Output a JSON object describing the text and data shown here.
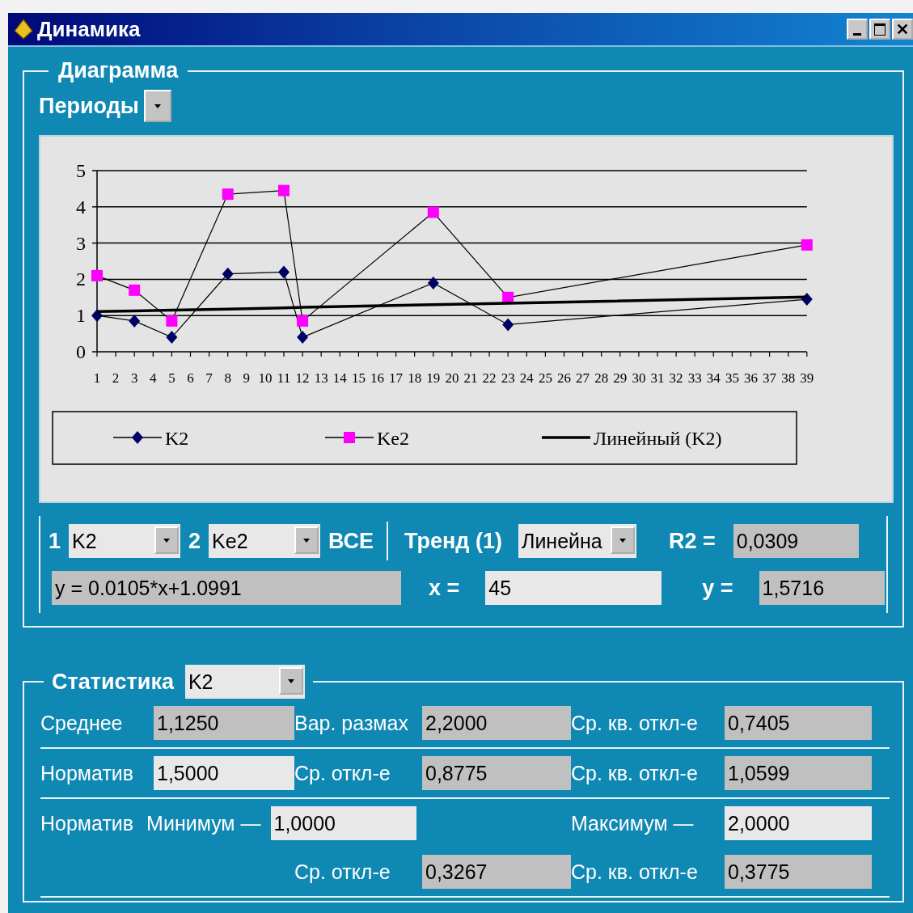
{
  "window": {
    "title": "Динамика"
  },
  "diagram": {
    "title": "Диаграмма",
    "periods_label": "Периоды",
    "chart_data": {
      "type": "line",
      "x": [
        1,
        3,
        5,
        8,
        11,
        12,
        19,
        23,
        39
      ],
      "series": [
        {
          "name": "K2",
          "color": "#000066",
          "marker": "diamond",
          "values": [
            1.0,
            0.85,
            0.4,
            2.15,
            2.2,
            0.4,
            1.9,
            0.75,
            1.45
          ]
        },
        {
          "name": "Ke2",
          "color": "#ff00ff",
          "marker": "square",
          "values": [
            2.1,
            1.7,
            0.85,
            4.35,
            4.45,
            0.85,
            3.85,
            1.5,
            2.95
          ]
        },
        {
          "name": "Линейный (K2)",
          "color": "#000000",
          "marker": "none",
          "values": [
            1.11,
            1.13,
            1.15,
            1.18,
            1.21,
            1.23,
            1.3,
            1.34,
            1.51
          ]
        }
      ],
      "xlim": [
        1,
        39
      ],
      "ylim": [
        0,
        5
      ],
      "grid": true,
      "legend": true,
      "xticks": [
        1,
        2,
        3,
        4,
        5,
        6,
        7,
        8,
        9,
        10,
        11,
        12,
        13,
        14,
        15,
        16,
        17,
        18,
        19,
        20,
        21,
        22,
        23,
        24,
        25,
        26,
        27,
        28,
        29,
        30,
        31,
        32,
        33,
        34,
        35,
        36,
        37,
        38,
        39
      ],
      "yticks": [
        0,
        1,
        2,
        3,
        4,
        5
      ]
    },
    "series_1": {
      "label": "1",
      "value": "K2"
    },
    "series_2": {
      "label": "2",
      "value": "Ke2"
    },
    "all_label": "ВСЕ",
    "trend_label": "Тренд (1)",
    "trend_type": "Линейна",
    "r2_label": "R2 =",
    "r2_value": "0,0309",
    "equation": "y = 0.0105*x+1.0991",
    "x_label": "x =",
    "x_value": "45",
    "y_label": "y =",
    "y_value": "1,5716"
  },
  "statistics": {
    "title": "Статистика",
    "series": "K2",
    "rows": [
      {
        "kind": "standard",
        "pairs": [
          {
            "label": "Среднее",
            "value": "1,1250",
            "editable": false
          },
          {
            "label": "Вар. размах",
            "value": "2,2000",
            "editable": false
          },
          {
            "label": "Ср. кв. откл-е",
            "value": "0,7405",
            "editable": false
          }
        ]
      },
      {
        "kind": "standard",
        "pairs": [
          {
            "label": "Норматив",
            "value": "1,5000",
            "editable": true
          },
          {
            "label": "Ср. откл-е",
            "value": "0,8775",
            "editable": false
          },
          {
            "label": "Ср. кв. откл-е",
            "value": "1,0599",
            "editable": false
          }
        ]
      },
      {
        "kind": "range",
        "label": "Норматив",
        "pairs": [
          {
            "label": "Минимум —",
            "value": "1,0000",
            "editable": true
          },
          {
            "label": "Максимум —",
            "value": "2,0000",
            "editable": true
          }
        ]
      },
      {
        "kind": "standard",
        "pairs": [
          {
            "label": "Ср. откл-е",
            "value": "0,3267",
            "editable": false
          },
          {
            "label": "Ср. кв. откл-е",
            "value": "0,3775",
            "editable": false
          }
        ]
      }
    ]
  }
}
